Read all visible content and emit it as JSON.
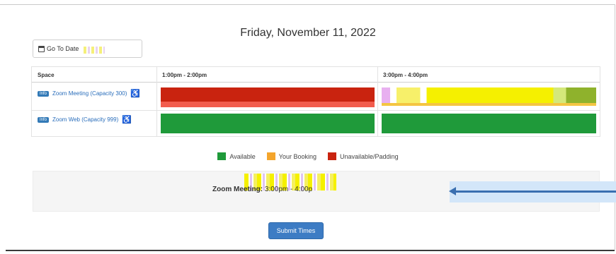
{
  "header": {
    "date": "Friday, November 11, 2022"
  },
  "toolbar": {
    "goto_label": "Go To Date",
    "goto_icon": "calendar-icon"
  },
  "grid": {
    "space_header": "Space",
    "time_columns": [
      "1:00pm - 2:00pm",
      "3:00pm - 4:00pm"
    ],
    "spaces": [
      {
        "info": "Info",
        "name": "Zoom Meeting (Capacity 300)",
        "icon": "wheelchair-icon",
        "slots": [
          "unavailable",
          "your-booking"
        ]
      },
      {
        "info": "Info",
        "name": "Zoom Web (Capacity 999)",
        "icon": "wheelchair-icon",
        "slots": [
          "available",
          "available"
        ]
      }
    ]
  },
  "legend": [
    {
      "label": "Available",
      "color": "#1f9a3a"
    },
    {
      "label": "Your Booking",
      "color": "#f4a52c"
    },
    {
      "label": "Unavailable/Padding",
      "color": "#c9230f"
    }
  ],
  "selection": {
    "label": "Zoom Meeting:",
    "time": "3:00pm - 4:00p"
  },
  "actions": {
    "submit_label": "Submit Times"
  }
}
